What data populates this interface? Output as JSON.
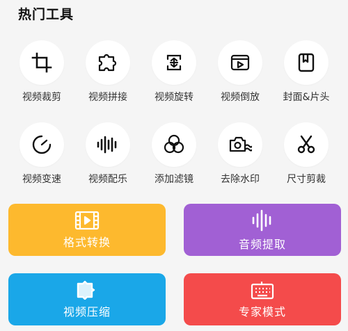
{
  "section": {
    "title": "热门工具"
  },
  "tools": [
    {
      "label": "视频裁剪",
      "icon": "crop-icon"
    },
    {
      "label": "视频拼接",
      "icon": "puzzle-icon"
    },
    {
      "label": "视频旋转",
      "icon": "rotate-icon"
    },
    {
      "label": "视频倒放",
      "icon": "reverse-play-icon"
    },
    {
      "label": "封面&片头",
      "icon": "bookmark-icon"
    },
    {
      "label": "视频变速",
      "icon": "speedometer-icon"
    },
    {
      "label": "视频配乐",
      "icon": "soundwave-icon"
    },
    {
      "label": "添加滤镜",
      "icon": "filter-icon"
    },
    {
      "label": "去除水印",
      "icon": "watermark-icon"
    },
    {
      "label": "尺寸剪裁",
      "icon": "scissors-icon"
    }
  ],
  "cards": [
    {
      "label": "格式转换",
      "icon": "film-icon",
      "color": "#fdb92e"
    },
    {
      "label": "音频提取",
      "icon": "audio-wave-icon",
      "color": "#a160d4"
    },
    {
      "label": "视频压缩",
      "icon": "compress-icon",
      "color": "#1aa7e8"
    },
    {
      "label": "专家模式",
      "icon": "keyboard-icon",
      "color": "#f44b4b"
    }
  ]
}
